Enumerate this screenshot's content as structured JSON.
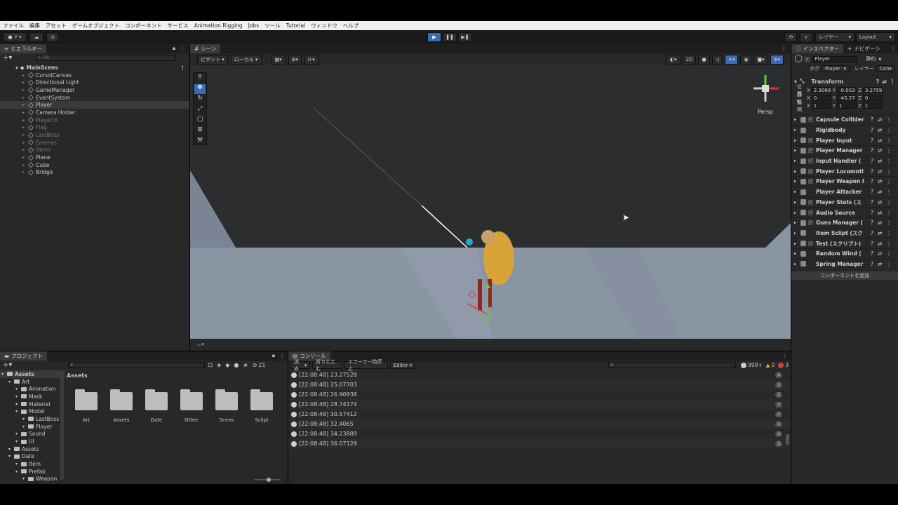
{
  "menu": [
    "ファイル",
    "編集",
    "アセット",
    "ゲームオブジェクト",
    "コンポーネント",
    "サービス",
    "Animation Rigging",
    "Jobs",
    "ツール",
    "Tutorial",
    "ウィンドウ",
    "ヘルプ"
  ],
  "toolbar": {
    "account_label": "Y",
    "layers_label": "レイヤー",
    "layout_label": "Layout"
  },
  "hierarchy": {
    "tab": "ヒエラルキー",
    "search_placeholder": "All",
    "scene": "MainScens",
    "items": [
      {
        "name": "CursolCanvas",
        "dim": false
      },
      {
        "name": "Directional Light",
        "dim": false
      },
      {
        "name": "GameManager",
        "dim": false
      },
      {
        "name": "EventSystem",
        "dim": false
      },
      {
        "name": "Player",
        "dim": false
      },
      {
        "name": "Camera Holder",
        "dim": false
      },
      {
        "name": "PlayerUI",
        "dim": true
      },
      {
        "name": "Flag",
        "dim": true
      },
      {
        "name": "LastBoss",
        "dim": true
      },
      {
        "name": "Enemys",
        "dim": true
      },
      {
        "name": "Items",
        "dim": true
      },
      {
        "name": "Plane",
        "dim": false
      },
      {
        "name": "Cube",
        "dim": false
      },
      {
        "name": "Bridge",
        "dim": false
      }
    ]
  },
  "scene": {
    "tab": "シーン",
    "pivot_label": "ピボット",
    "local_label": "ローカル",
    "mode_2d": "2D",
    "persp_label": "Persp"
  },
  "inspector": {
    "tab": "インスペクター",
    "tab2": "ナビゲーシ",
    "object_name": "Player",
    "static_label": "静的",
    "tag_label": "タグ",
    "tag_value": "Player",
    "layer_label": "レイヤー",
    "layer_value": "Con",
    "transform_title": "Transform",
    "position_label": "位置",
    "rotation_label": "回転",
    "scale_label": "拡縮",
    "position": {
      "x": "2.3068",
      "y": "-0.003",
      "z": "3.2759"
    },
    "rotation": {
      "x": "0",
      "y": "-43.27",
      "z": "0"
    },
    "scale": {
      "x": "1",
      "y": "1",
      "z": "1"
    },
    "components": [
      {
        "name": "Capsule Collider",
        "checked": true
      },
      {
        "name": "Rigidbody",
        "checked": false
      },
      {
        "name": "Player Input",
        "checked": true
      },
      {
        "name": "Player Manager",
        "checked": true
      },
      {
        "name": "Input Handler (",
        "checked": true
      },
      {
        "name": "Player Locomoti",
        "checked": true
      },
      {
        "name": "Player Weapon I",
        "checked": true
      },
      {
        "name": "Player Attacker",
        "checked": false
      },
      {
        "name": "Player Stats (ス",
        "checked": true
      },
      {
        "name": "Audio Source",
        "checked": true
      },
      {
        "name": "Guns Manager (",
        "checked": true
      },
      {
        "name": "Item Sclipt (スク",
        "checked": false
      },
      {
        "name": "Test (スクリプト)",
        "checked": true
      },
      {
        "name": "Random Wind (",
        "checked": false
      },
      {
        "name": "Spring Manager",
        "checked": false
      }
    ],
    "add_component": "コンポーネントを追加"
  },
  "project": {
    "tab": "プロジェクト",
    "count": "21",
    "breadcrumb": "Assets",
    "tree": [
      {
        "name": "Assets",
        "indent": 0,
        "bold": true
      },
      {
        "name": "Art",
        "indent": 1
      },
      {
        "name": "Animation",
        "indent": 2
      },
      {
        "name": "Mask",
        "indent": 2
      },
      {
        "name": "Material",
        "indent": 2
      },
      {
        "name": "Model",
        "indent": 2
      },
      {
        "name": "LastBoss",
        "indent": 3
      },
      {
        "name": "Player",
        "indent": 3
      },
      {
        "name": "Sound",
        "indent": 2
      },
      {
        "name": "UI",
        "indent": 2
      },
      {
        "name": "Assets",
        "indent": 1
      },
      {
        "name": "Date",
        "indent": 1
      },
      {
        "name": "Item",
        "indent": 2
      },
      {
        "name": "Prefab",
        "indent": 2
      },
      {
        "name": "Weapon",
        "indent": 3
      }
    ],
    "folders": [
      "Art",
      "Assets",
      "Date",
      "Other",
      "Scens",
      "Sclipt"
    ]
  },
  "console": {
    "tab": "コンソール",
    "clear": "消去",
    "collapse": "折りたたむ",
    "pause_on_error": "エラーで一時停止",
    "editor": "Editor",
    "log_count": "999+",
    "warn_count": "0",
    "error_count": "3",
    "rows": [
      {
        "text": "[22:08:48] 23.27528",
        "count": "1"
      },
      {
        "text": "[22:08:48] 25.07703",
        "count": "1"
      },
      {
        "text": "[22:08:48] 26.90938",
        "count": "1"
      },
      {
        "text": "[22:08:48] 28.74174",
        "count": "1"
      },
      {
        "text": "[22:08:48] 30.57412",
        "count": "2"
      },
      {
        "text": "[22:08:48] 32.4065",
        "count": "1"
      },
      {
        "text": "[22:08:48] 34.23889",
        "count": "1"
      },
      {
        "text": "[22:08:48] 36.07129",
        "count": "1"
      }
    ]
  },
  "colors": {
    "accent": "#2f72d2",
    "play": "#3d6ab5",
    "error": "#d63c3c"
  }
}
